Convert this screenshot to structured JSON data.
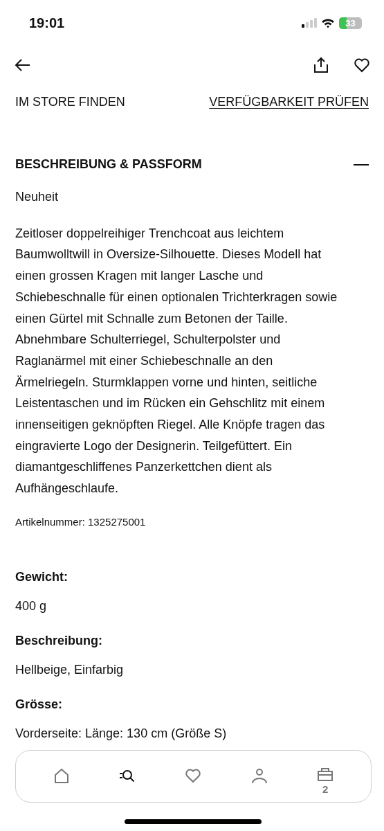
{
  "status_bar": {
    "time": "19:01",
    "battery": "33"
  },
  "actions": {
    "find_in_store": "IM STORE FINDEN",
    "check_availability": "VERFÜGBARKEIT PRÜFEN"
  },
  "section": {
    "title": "BESCHREIBUNG & PASSFORM",
    "expanded": true,
    "label": "Neuheit",
    "description": "Zeitloser doppelreihiger Trenchcoat aus leichtem Baumwolltwill in Oversize-Silhouette. Dieses Modell hat einen grossen Kragen mit langer Lasche und Schiebeschnalle für einen optionalen Trichterkragen sowie einen Gürtel mit Schnalle zum Betonen der Taille. Abnehmbare Schulterriegel, Schulterpolster und Raglanärmel mit einer Schiebeschnalle an den Ärmelriegeln. Sturmklappen vorne und hinten, seitliche Leistentaschen und im Rücken ein Gehschlitz mit einem innenseitigen geknöpften Riegel. Alle Knöpfe tragen das eingravierte Logo der Designerin. Teilgefüttert. Ein diamantgeschliffenes Panzerkettchen dient als Aufhängeschlaufe.",
    "article_number": "Artikelnummer: 1325275001"
  },
  "details": [
    {
      "label": "Gewicht:",
      "value": "400 g"
    },
    {
      "label": "Beschreibung:",
      "value": "Hellbeige, Einfarbig"
    },
    {
      "label": "Grösse:",
      "value": "Vorderseite: Länge: 130 cm (Größe S)"
    }
  ],
  "tab_bar": [
    {
      "kind": "home",
      "selected": false
    },
    {
      "kind": "search",
      "selected": true
    },
    {
      "kind": "favorites",
      "selected": false
    },
    {
      "kind": "account",
      "selected": false
    },
    {
      "kind": "bag",
      "selected": false,
      "count": "2"
    }
  ]
}
